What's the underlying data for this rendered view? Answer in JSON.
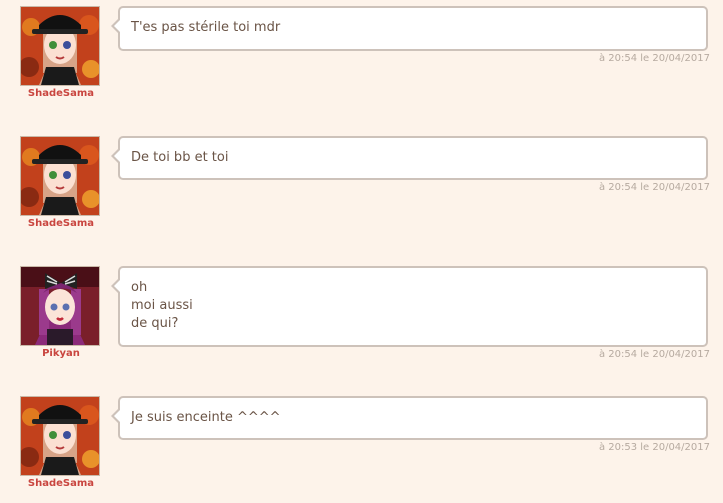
{
  "messages": [
    {
      "author": "ShadeSama",
      "avatar": "shadesama-avatar",
      "lines": [
        "T'es pas stérile toi mdr"
      ],
      "timestamp": "à 20:54 le 20/04/2017"
    },
    {
      "author": "ShadeSama",
      "avatar": "shadesama-avatar",
      "lines": [
        "De toi bb et toi"
      ],
      "timestamp": "à 20:54 le 20/04/2017"
    },
    {
      "author": "Pikyan",
      "avatar": "pikyan-avatar",
      "lines": [
        "oh",
        "moi aussi",
        "de qui?"
      ],
      "timestamp": "à 20:54 le 20/04/2017"
    },
    {
      "author": "ShadeSama",
      "avatar": "shadesama-avatar",
      "lines": [
        "Je suis enceinte ^^^^"
      ],
      "timestamp": "à 20:53 le 20/04/2017"
    }
  ],
  "colors": {
    "background": "#fdf3ea",
    "username": "#c9453f",
    "bubble_border": "#cdc2ba",
    "message_text": "#6a5446",
    "timestamp": "#b6aaa0"
  }
}
